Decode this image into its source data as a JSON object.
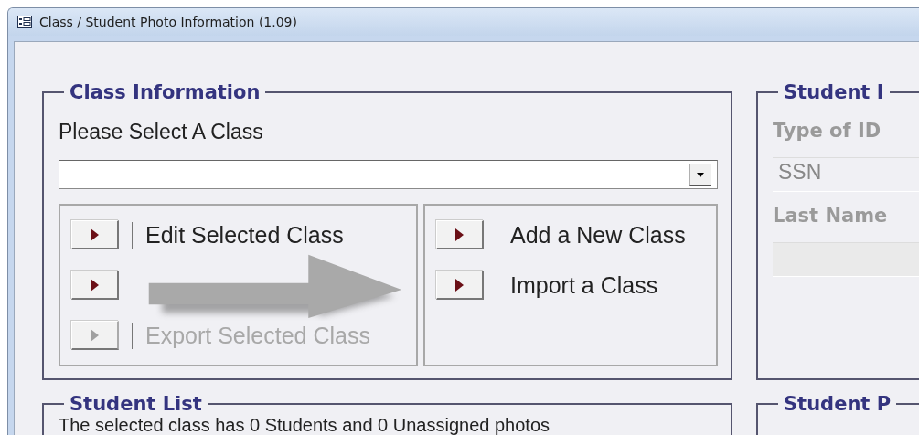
{
  "window": {
    "title": "Class / Student Photo Information (1.09)"
  },
  "class_information": {
    "legend": "Class Information",
    "select_label": "Please Select A Class",
    "button_groups": [
      [
        {
          "label": "Edit Selected Class",
          "disabled": false
        },
        {
          "disabled": false
        },
        {
          "label": "Export Selected Class",
          "disabled": true
        }
      ],
      [
        {
          "label": "Add a New Class",
          "disabled": false
        },
        {
          "label": "Import a Class",
          "disabled": false
        }
      ]
    ]
  },
  "student_information": {
    "legend": "Student I",
    "fields": [
      {
        "label": "Type of ID",
        "value": "SSN"
      },
      {
        "label": "Last Name"
      }
    ]
  },
  "student_list": {
    "legend": "Student List",
    "summary": "The selected class has 0 Students and 0 Unassigned photos"
  },
  "student_photo": {
    "legend": "Student P"
  }
}
